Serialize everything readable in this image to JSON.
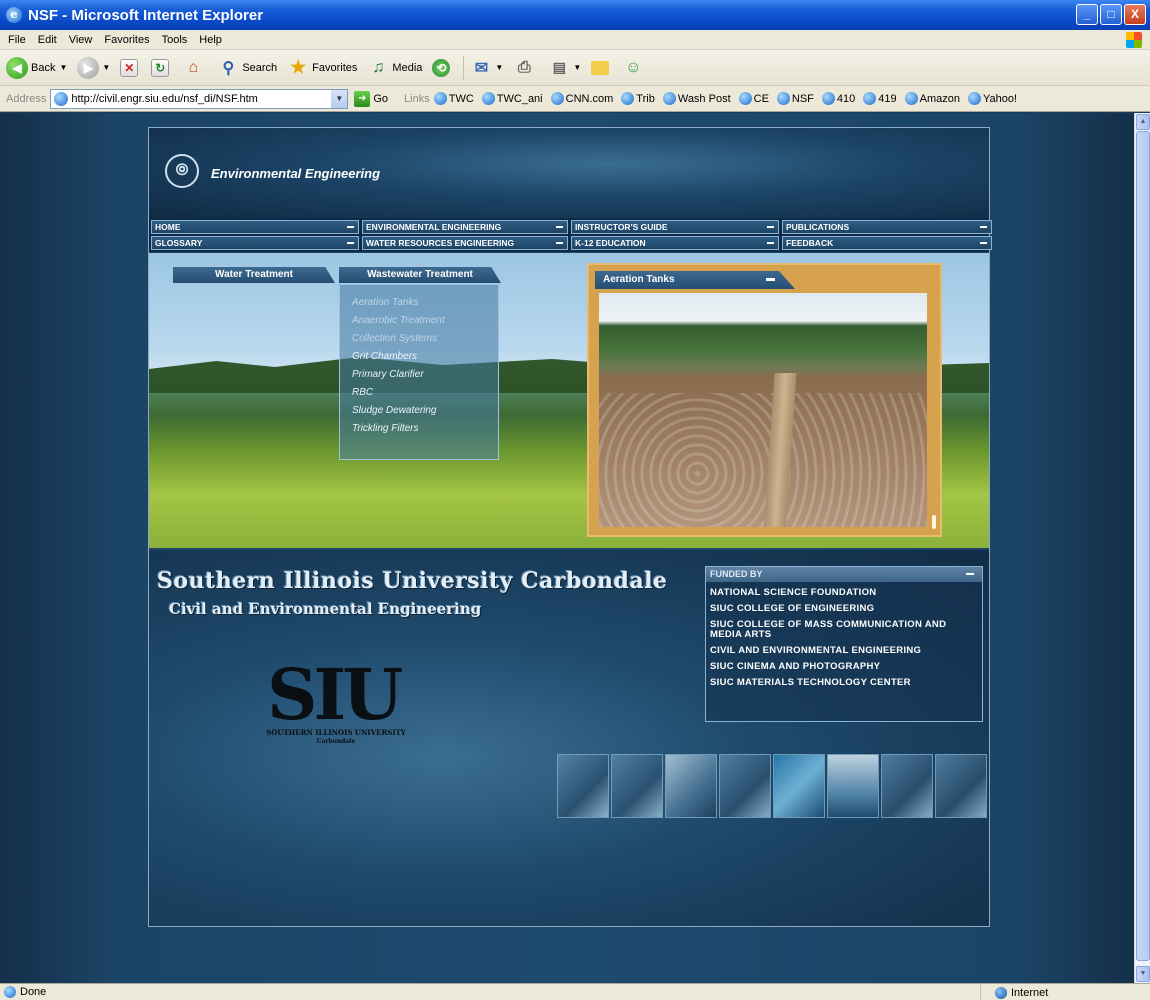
{
  "window": {
    "title": "NSF - Microsoft Internet Explorer",
    "controls": {
      "minimize": "_",
      "maximize": "□",
      "close": "X"
    }
  },
  "menubar": [
    "File",
    "Edit",
    "View",
    "Favorites",
    "Tools",
    "Help"
  ],
  "toolbar": {
    "back_label": "Back",
    "search_label": "Search",
    "favorites_label": "Favorites",
    "media_label": "Media"
  },
  "addressbar": {
    "label": "Address",
    "url": "http://civil.engr.siu.edu/nsf_di/NSF.htm",
    "go_label": "Go",
    "links_label": "Links",
    "links": [
      "TWC",
      "TWC_ani",
      "CNN.com",
      "Trib",
      "Wash Post",
      "CE",
      "NSF",
      "410",
      "419",
      "Amazon",
      "Yahoo!"
    ]
  },
  "site": {
    "title": "Environmental Engineering",
    "nav": [
      "HOME",
      "ENVIRONMENTAL ENGINEERING",
      "INSTRUCTOR'S GUIDE",
      "PUBLICATIONS",
      "GLOSSARY",
      "WATER RESOURCES ENGINEERING",
      "K-12 EDUCATION",
      "FEEDBACK"
    ],
    "tabs": {
      "water": "Water Treatment",
      "wastewater": "Wastewater Treatment"
    },
    "submenu": [
      "Aeration Tanks",
      "Anaerobic Treatment",
      "Collection Systems",
      "Grit Chambers",
      "Primary Clarifier",
      "RBC",
      "Sludge Dewatering",
      "Trickling Filters"
    ],
    "photo_title": "Aeration Tanks",
    "university": "Southern Illinois University Carbondale",
    "department": "Civil and Environmental Engineering",
    "logo_text": "SIU",
    "logo_sub": "SOUTHERN ILLINOIS UNIVERSITY",
    "logo_sub2": "Carbondale",
    "funded_by": {
      "heading": "FUNDED BY",
      "items": [
        "NATIONAL SCIENCE FOUNDATION",
        "SIUC COLLEGE OF ENGINEERING",
        "SIUC COLLEGE OF MASS COMMUNICATION AND MEDIA ARTS",
        "CIVIL AND ENVIRONMENTAL ENGINEERING",
        "SIUC CINEMA AND PHOTOGRAPHY",
        "SIUC MATERIALS TECHNOLOGY CENTER"
      ]
    }
  },
  "statusbar": {
    "text": "Done",
    "zone": "Internet"
  },
  "colors": {
    "title_bar": "#0b49c9",
    "page_bg": "#1e4a6e",
    "photo_frame": "#d7a24e"
  }
}
